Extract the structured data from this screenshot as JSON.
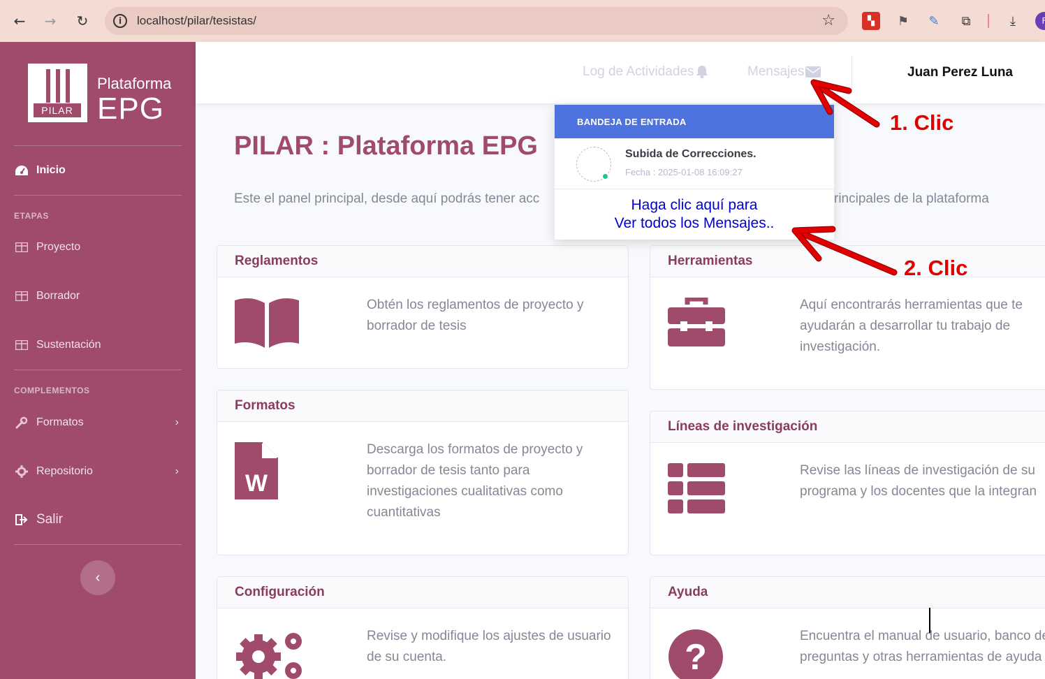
{
  "browser": {
    "url": "localhost/pilar/tesistas/",
    "profile_initial": "F"
  },
  "sidebar": {
    "brand_box_label": "PILAR",
    "brand_title_small": "Plataforma",
    "brand_title_big": "EPG",
    "home": "Inicio",
    "section_etapas": "ETAPAS",
    "items_etapas": [
      "Proyecto",
      "Borrador",
      "Sustentación"
    ],
    "section_complementos": "COMPLEMENTOS",
    "items_complementos": [
      "Formatos",
      "Repositorio"
    ],
    "logout": "Salir"
  },
  "topbar": {
    "activity_log": "Log de Actividades",
    "messages": "Mensajes",
    "user_name": "Juan Perez Luna"
  },
  "main": {
    "title": "PILAR : Plataforma EPG",
    "description": "Este el panel principal, desde aquí podrás tener acc",
    "description_tail": "rincipales de la plataforma"
  },
  "cards": {
    "reglamentos": {
      "title": "Reglamentos",
      "text": "Obtén los reglamentos de proyecto y borrador de tesis"
    },
    "herramientas": {
      "title": "Herramientas",
      "text": "Aquí encontrarás herramientas que te ayudarán a desarrollar tu trabajo de investigación."
    },
    "formatos": {
      "title": "Formatos",
      "text": "Descarga los formatos de proyecto y borrador de tesis tanto para investigaciones cualitativas como cuantitativas"
    },
    "lineas": {
      "title": "Líneas de investigación",
      "text": "Revise las líneas de investigación de su programa y los docentes que la integran"
    },
    "configuracion": {
      "title": "Configuración",
      "text": "Revise y modifique los ajustes de usuario de su cuenta."
    },
    "ayuda": {
      "title": "Ayuda",
      "text": "Encuentra el manual de usuario, banco de preguntas y otras herramientas de ayuda"
    }
  },
  "dropdown": {
    "header": "BANDEJA DE ENTRADA",
    "message_subject": "Subida de Correcciones.",
    "message_date": "Fecha : 2025-01-08 16:09:27",
    "view_all_line1": "Haga clic aquí para",
    "view_all_line2": "Ver todos los Mensajes.."
  },
  "annotations": {
    "step1": "1. Clic",
    "step2": "2. Clic"
  },
  "colors": {
    "brand": "#a04a6c",
    "dropdown_header": "#4e73df",
    "annotation": "#e00000",
    "link": "#0000d6"
  }
}
